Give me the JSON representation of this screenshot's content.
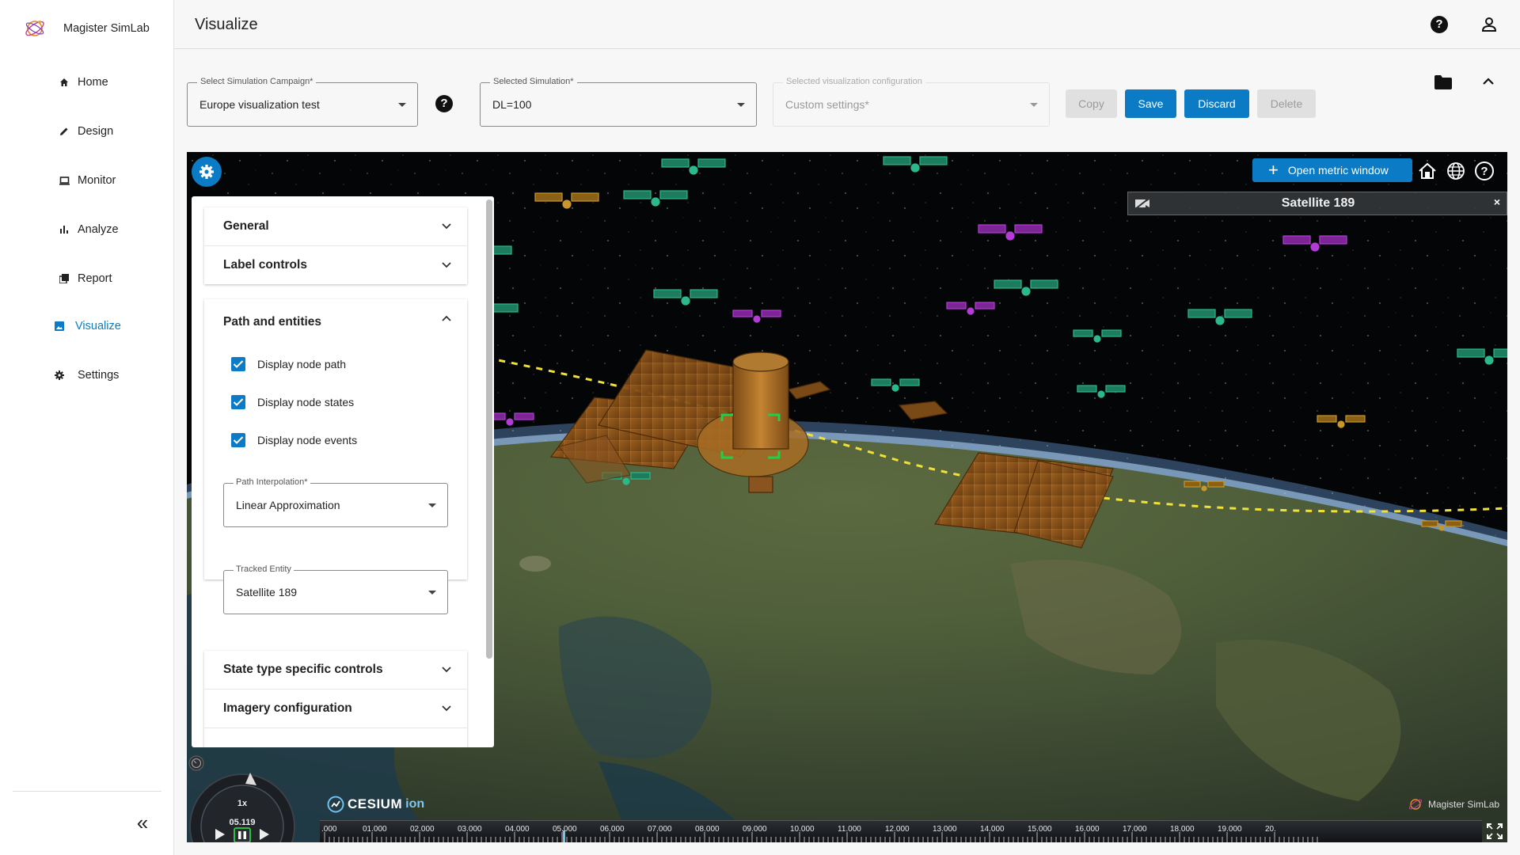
{
  "app": {
    "name": "Magister SimLab"
  },
  "sidebar": {
    "items": [
      {
        "label": "Home",
        "icon": "home-icon"
      },
      {
        "label": "Design",
        "icon": "pencil-icon"
      },
      {
        "label": "Monitor",
        "icon": "monitor-icon"
      },
      {
        "label": "Analyze",
        "icon": "bar-chart-icon"
      },
      {
        "label": "Report",
        "icon": "report-icon"
      },
      {
        "label": "Visualize",
        "icon": "image-icon",
        "active": true
      },
      {
        "label": "Settings",
        "icon": "gear-icon"
      }
    ],
    "collapse_label": "«"
  },
  "header": {
    "title": "Visualize"
  },
  "toolbar": {
    "campaign": {
      "label": "Select Simulation Campaign*",
      "value": "Europe visualization test"
    },
    "simulation": {
      "label": "Selected Simulation*",
      "value": "DL=100"
    },
    "config": {
      "label": "Selected visualization configuration",
      "value": "Custom settings*"
    },
    "buttons": {
      "copy": "Copy",
      "save": "Save",
      "discard": "Discard",
      "delete": "Delete"
    }
  },
  "panel": {
    "sections": {
      "general": "General",
      "label_controls": "Label controls",
      "path_entities": "Path and entities",
      "state_type": "State type specific controls",
      "imagery": "Imagery configuration"
    },
    "checkboxes": [
      {
        "label": "Display node path",
        "checked": true
      },
      {
        "label": "Display node states",
        "checked": true
      },
      {
        "label": "Display node events",
        "checked": true
      }
    ],
    "path_interpolation": {
      "label": "Path Interpolation*",
      "value": "Linear Approximation"
    },
    "tracked_entity": {
      "label": "Tracked Entity",
      "value": "Satellite 189"
    }
  },
  "viewer": {
    "metric_button": "Open metric window",
    "infobox_title": "Satellite 189",
    "infobox_close": "×",
    "cesium_word": "CESIUM",
    "cesium_ion": "ion",
    "credit": "Magister SimLab",
    "animation": {
      "speed": "1x",
      "time": "05.119"
    },
    "timeline_ticks": [
      ".000",
      "01.000",
      "02.000",
      "03.000",
      "04.000",
      "05.000",
      "06.000",
      "07.000",
      "08.000",
      "09.000",
      "10.000",
      "11.000",
      "12.000",
      "13.000",
      "14.000",
      "15.000",
      "16.000",
      "17.000",
      "18.000",
      "19.000",
      "20."
    ]
  },
  "colors": {
    "accent": "#0a7bc4",
    "satellite_green": "#2bb98a",
    "satellite_purple": "#b43cd6",
    "satellite_gold": "#c8962a",
    "path_yellow": "#f2e03a"
  }
}
